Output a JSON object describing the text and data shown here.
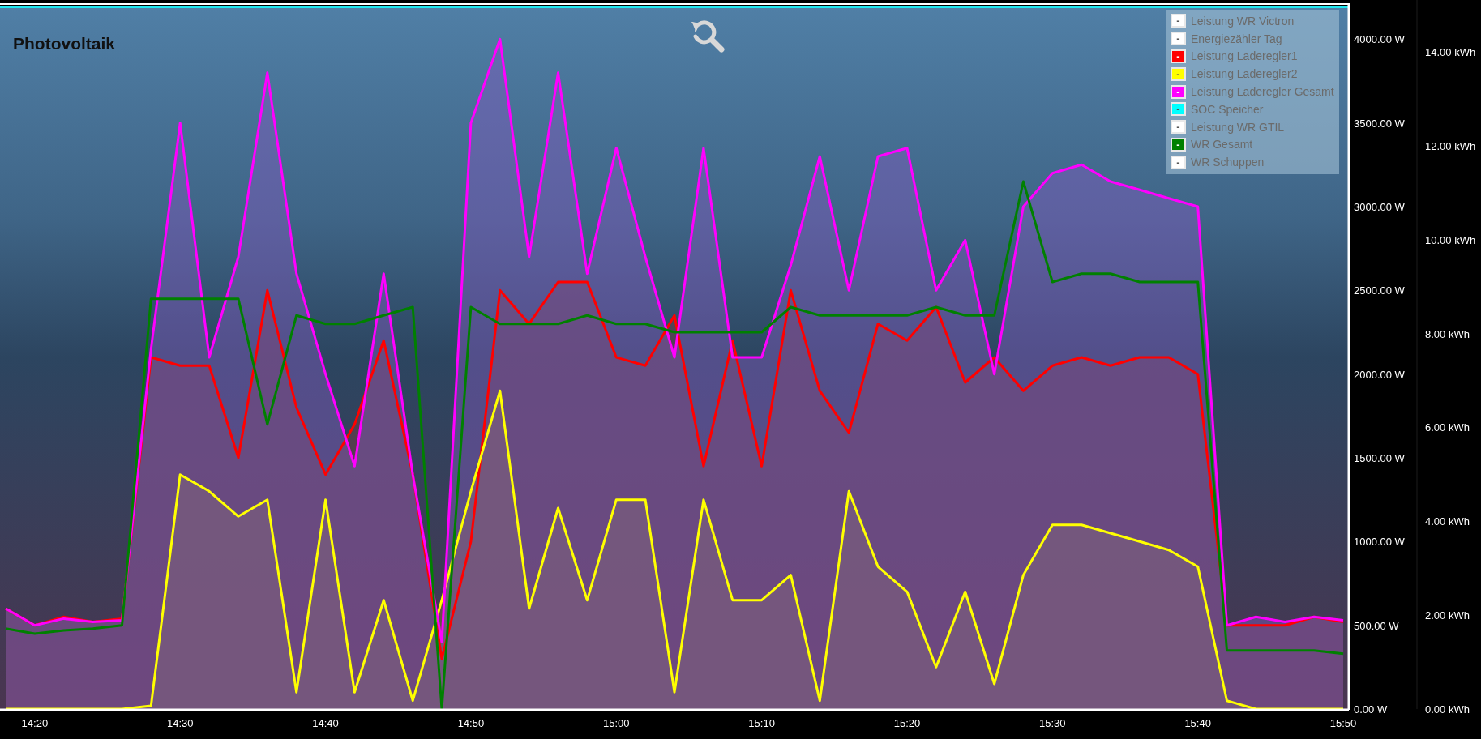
{
  "title": "Photovoltaik",
  "chart_data": {
    "type": "area",
    "categories": [
      null,
      "14:20",
      null,
      null,
      null,
      null,
      "14:30",
      null,
      null,
      null,
      null,
      "14:40",
      null,
      null,
      null,
      null,
      "14:50",
      null,
      null,
      null,
      null,
      "15:00",
      null,
      null,
      null,
      null,
      "15:10",
      null,
      null,
      null,
      null,
      "15:20",
      null,
      null,
      null,
      null,
      "15:30",
      null,
      null,
      null,
      null,
      "15:40",
      null,
      null,
      null,
      null,
      "15:50"
    ],
    "series": [
      {
        "name": "Leistung WR Victron",
        "color": "#ffffff",
        "type": "line",
        "values": [
          null,
          null,
          null,
          null,
          null,
          null,
          null,
          null,
          null,
          null,
          null,
          null,
          null,
          null,
          null,
          null,
          null,
          null,
          null,
          null,
          null,
          null,
          null,
          null,
          null,
          null,
          null,
          null,
          null,
          null,
          null,
          null,
          null,
          null,
          null,
          null,
          null,
          null,
          null,
          null,
          null,
          null,
          null,
          null,
          null,
          null,
          null
        ]
      },
      {
        "name": "Energiezähler Tag",
        "color": "#ffffff",
        "type": "line",
        "values": [
          null,
          null,
          null,
          null,
          null,
          null,
          null,
          null,
          null,
          null,
          null,
          null,
          null,
          null,
          null,
          null,
          null,
          null,
          null,
          null,
          null,
          null,
          null,
          null,
          null,
          null,
          null,
          null,
          null,
          null,
          null,
          null,
          null,
          null,
          null,
          null,
          null,
          null,
          null,
          null,
          null,
          null,
          null,
          null,
          null,
          null,
          null
        ]
      },
      {
        "name": "Leistung Laderegler1",
        "color": "#ff0000",
        "type": "area",
        "values": [
          600,
          500,
          550,
          520,
          540,
          2100,
          2050,
          2050,
          1500,
          2500,
          1800,
          1400,
          1700,
          2200,
          1400,
          300,
          1000,
          2500,
          2300,
          2550,
          2550,
          2100,
          2050,
          2350,
          1450,
          2200,
          1450,
          2500,
          1900,
          1650,
          2300,
          2200,
          2400,
          1950,
          2100,
          1900,
          2050,
          2100,
          2050,
          2100,
          2100,
          2000,
          500,
          500,
          500,
          550,
          520
        ]
      },
      {
        "name": "Leistung Laderegler2",
        "color": "#ffff00",
        "type": "area",
        "values": [
          0,
          0,
          0,
          0,
          0,
          20,
          1400,
          1300,
          1150,
          1250,
          100,
          1250,
          100,
          650,
          50,
          650,
          1300,
          1900,
          600,
          1200,
          650,
          1250,
          1250,
          100,
          1250,
          650,
          650,
          800,
          50,
          1300,
          850,
          700,
          250,
          700,
          150,
          800,
          1100,
          1100,
          1050,
          1000,
          950,
          850,
          50,
          0,
          0,
          0,
          0
        ]
      },
      {
        "name": "Leistung Laderegler Gesamt",
        "color": "#ff00ff",
        "type": "area",
        "values": [
          600,
          500,
          540,
          520,
          530,
          2150,
          3500,
          2100,
          2700,
          3800,
          2600,
          2000,
          1450,
          2600,
          1400,
          400,
          3500,
          4000,
          2700,
          3800,
          2600,
          3350,
          2700,
          2100,
          3350,
          2100,
          2100,
          2650,
          3300,
          2500,
          3300,
          3350,
          2500,
          2800,
          2000,
          3000,
          3200,
          3250,
          3150,
          3100,
          3050,
          3000,
          500,
          550,
          520,
          550,
          530
        ]
      },
      {
        "name": "SOC Speicher",
        "color": "#00ffff",
        "type": "line",
        "values": [
          null,
          null,
          null,
          null,
          null,
          null,
          null,
          null,
          null,
          null,
          null,
          null,
          null,
          null,
          null,
          null,
          null,
          null,
          null,
          null,
          null,
          null,
          null,
          null,
          null,
          null,
          null,
          null,
          null,
          null,
          null,
          null,
          null,
          null,
          null,
          null,
          null,
          null,
          null,
          null,
          null,
          null,
          null,
          null,
          null,
          null,
          null
        ]
      },
      {
        "name": "Leistung WR GTIL",
        "color": "#ffffff",
        "type": "line",
        "values": [
          null,
          null,
          null,
          null,
          null,
          null,
          null,
          null,
          null,
          null,
          null,
          null,
          null,
          null,
          null,
          null,
          null,
          null,
          null,
          null,
          null,
          null,
          null,
          null,
          null,
          null,
          null,
          null,
          null,
          null,
          null,
          null,
          null,
          null,
          null,
          null,
          null,
          null,
          null,
          null,
          null,
          null,
          null,
          null,
          null,
          null,
          null
        ]
      },
      {
        "name": "WR Gesamt",
        "color": "#008000",
        "type": "line",
        "values": [
          480,
          450,
          470,
          480,
          500,
          2450,
          2450,
          2450,
          2450,
          1700,
          2350,
          2300,
          2300,
          2350,
          2400,
          0,
          2400,
          2300,
          2300,
          2300,
          2350,
          2300,
          2300,
          2250,
          2250,
          2250,
          2250,
          2400,
          2350,
          2350,
          2350,
          2350,
          2400,
          2350,
          2350,
          3150,
          2550,
          2600,
          2600,
          2550,
          2550,
          2550,
          350,
          350,
          350,
          350,
          330
        ]
      },
      {
        "name": "WR Schuppen",
        "color": "#ffffff",
        "type": "line",
        "values": [
          null,
          null,
          null,
          null,
          null,
          null,
          null,
          null,
          null,
          null,
          null,
          null,
          null,
          null,
          null,
          null,
          null,
          null,
          null,
          null,
          null,
          null,
          null,
          null,
          null,
          null,
          null,
          null,
          null,
          null,
          null,
          null,
          null,
          null,
          null,
          null,
          null,
          null,
          null,
          null,
          null,
          null,
          null,
          null,
          null,
          null,
          null
        ]
      }
    ],
    "ylim": [
      0,
      4200
    ],
    "yticks": [
      {
        "value": 0,
        "label": "0.00 W"
      },
      {
        "value": 500,
        "label": "500.00 W"
      },
      {
        "value": 1000,
        "label": "1000.00 W"
      },
      {
        "value": 1500,
        "label": "1500.00 W"
      },
      {
        "value": 2000,
        "label": "2000.00 W"
      },
      {
        "value": 2500,
        "label": "2500.00 W"
      },
      {
        "value": 3000,
        "label": "3000.00 W"
      },
      {
        "value": 3500,
        "label": "3500.00 W"
      },
      {
        "value": 4000,
        "label": "4000.00 W"
      }
    ]
  },
  "legend_symbols": [
    "-",
    "-",
    "-",
    "-",
    "-",
    "-",
    "-",
    "-",
    "-"
  ],
  "kwh_axis_labels": [
    "14.00 kWh",
    "12.00 kWh",
    "10.00 kWh",
    "8.00 kWh",
    "6.00 kWh",
    "4.00 kWh",
    "2.00 kWh",
    "0.00 kWh"
  ]
}
